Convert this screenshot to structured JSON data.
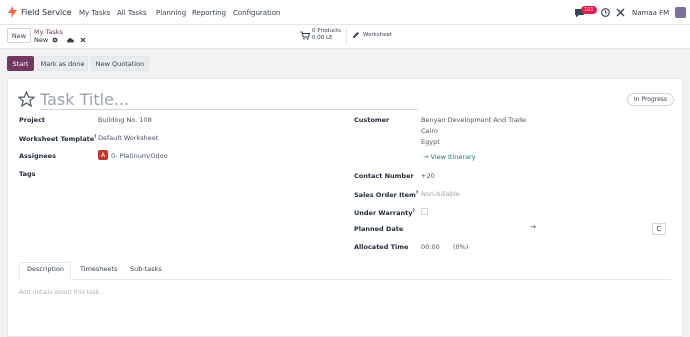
{
  "navbar": {
    "app_name": "Field Service",
    "menu": [
      "My Tasks",
      "All Tasks",
      "Planning",
      "Reporting",
      "Configuration"
    ],
    "chat_badge": "101",
    "company": "Namaa FM"
  },
  "breadcrumb": {
    "parent": "My Tasks",
    "current": "New"
  },
  "control": {
    "new_label": "New",
    "products_count": "0 Products",
    "products_total": "0.00 LE",
    "worksheet_label": "Worksheet"
  },
  "actions": {
    "start": "Start",
    "mark_done": "Mark as done",
    "new_quotation": "New Quotation"
  },
  "task": {
    "title_placeholder": "Task Title...",
    "stage": "In Progress"
  },
  "left_fields": {
    "project_label": "Project",
    "project_value": "Building No. 108",
    "worksheet_label": "Worksheet Template",
    "worksheet_sup": "?",
    "worksheet_value": "Default Worksheet",
    "assignees_label": "Assignees",
    "assignee_initial": "A",
    "assignee_name": "0- Platinum/Odoo",
    "tags_label": "Tags"
  },
  "right_fields": {
    "customer_label": "Customer",
    "customer_name": "Benyan Development And Trade",
    "customer_city": "Cairo",
    "customer_country": "Egypt",
    "itinerary_link": "View Itinerary",
    "contact_label": "Contact Number",
    "contact_value": "+20",
    "sales_label": "Sales Order Item",
    "sales_sup": "?",
    "sales_value": "Non-billable",
    "warranty_label": "Under Warranty",
    "warranty_sup": "?",
    "planned_label": "Planned Date",
    "allocated_label": "Allocated Time",
    "allocated_value": "00:00",
    "allocated_pct": "(0%)"
  },
  "tabs": [
    "Description",
    "Timesheets",
    "Sub-tasks"
  ],
  "description_placeholder": "Add details about this task..."
}
